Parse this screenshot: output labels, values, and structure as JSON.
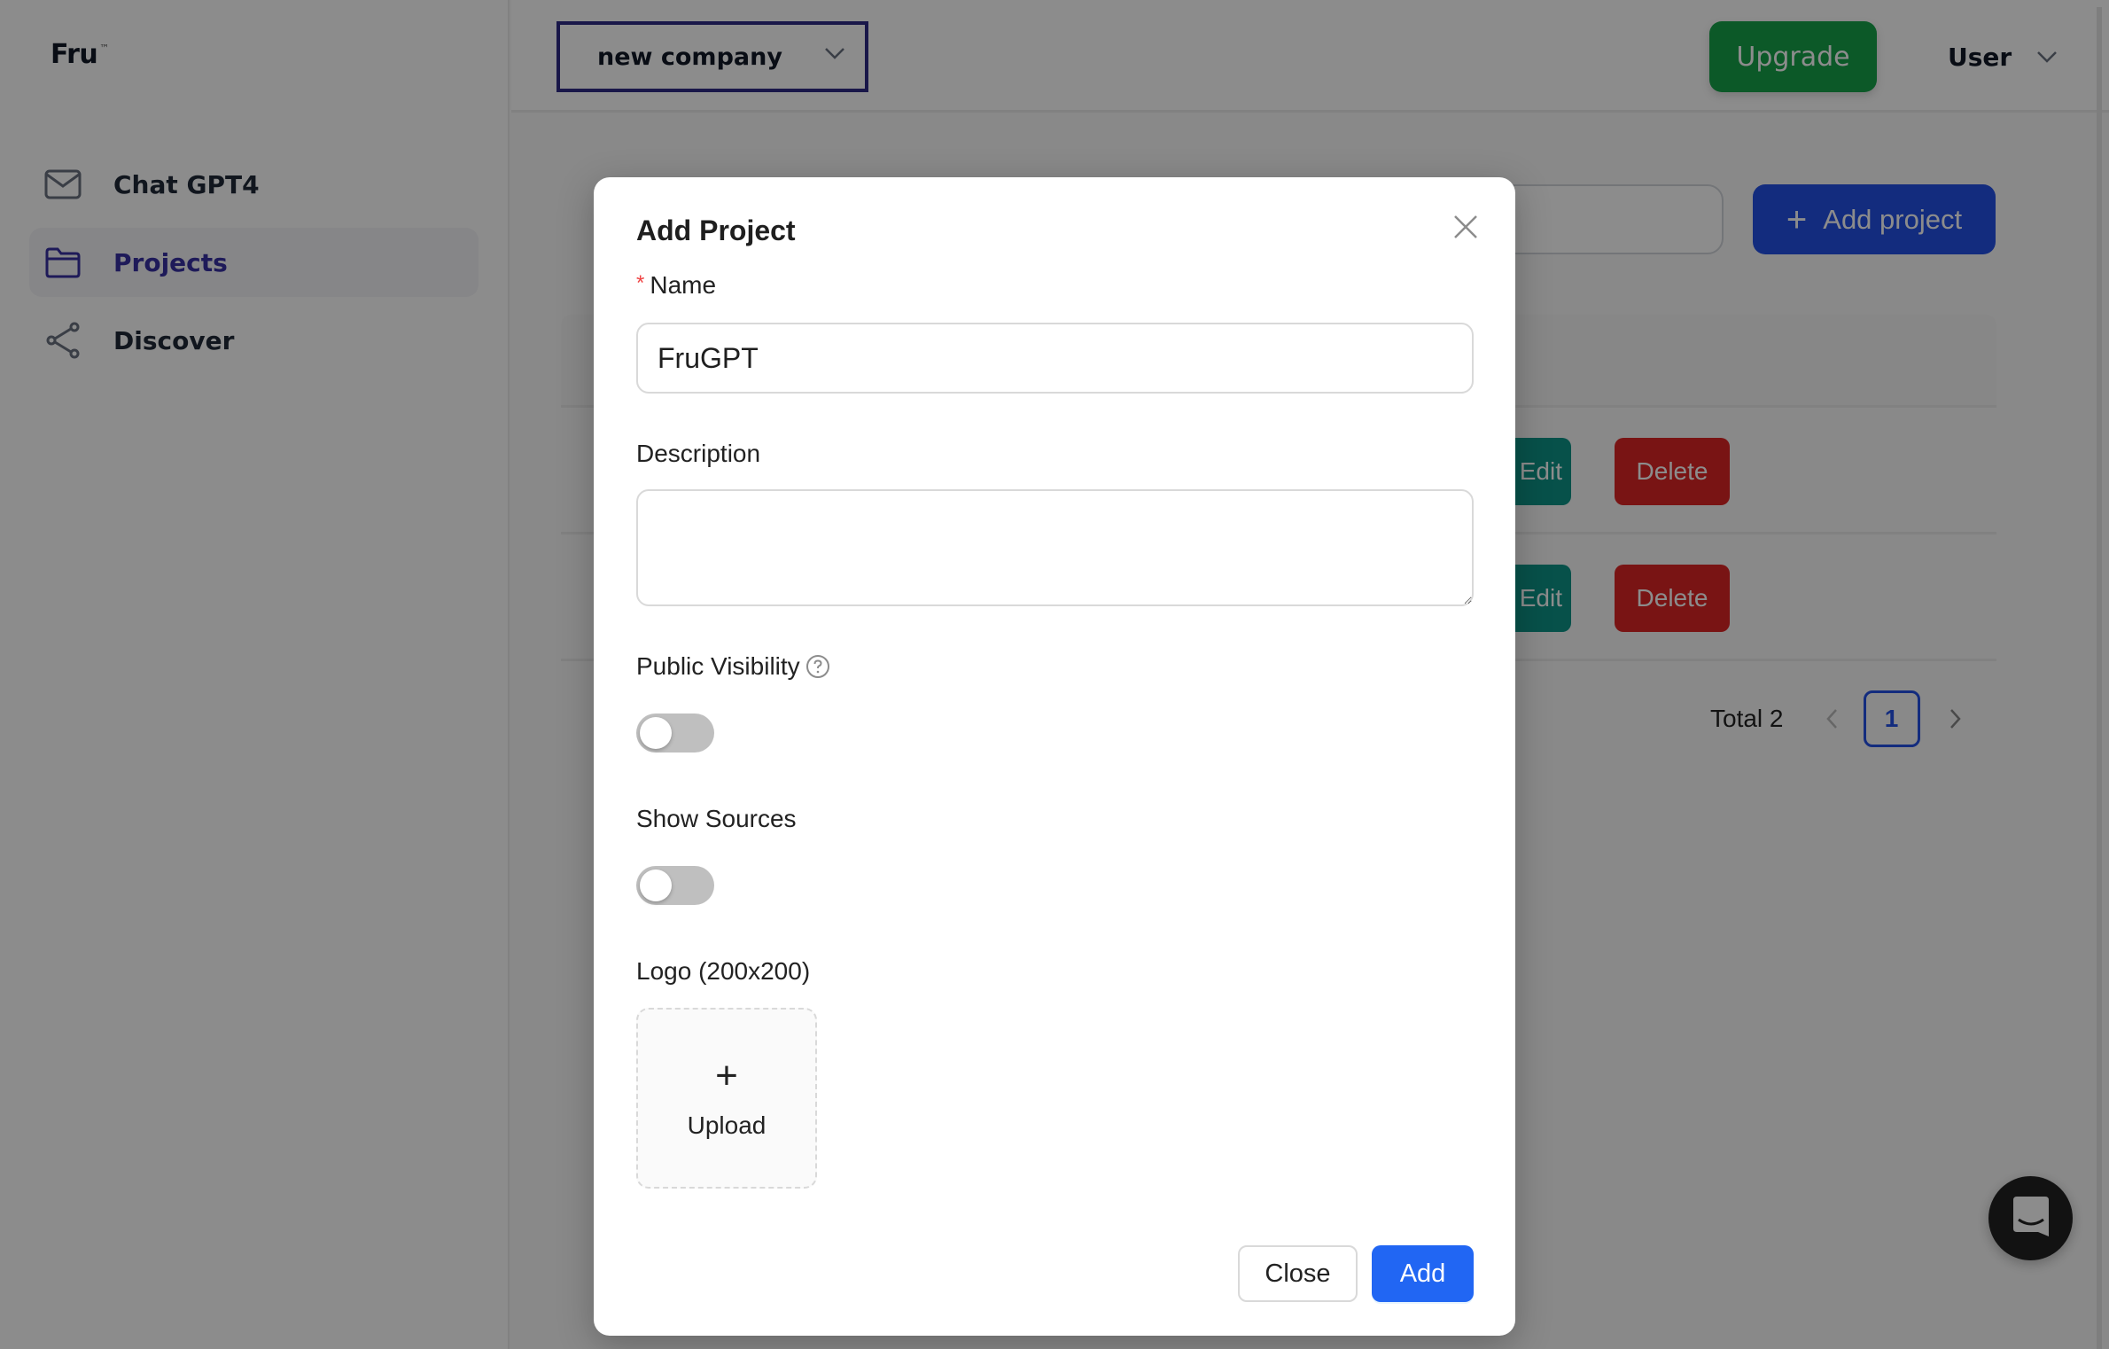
{
  "app": {
    "logo": "Fru",
    "logo_mark": "™"
  },
  "sidebar": {
    "items": [
      {
        "label": "Chat GPT4",
        "icon": "mail-icon",
        "active": false
      },
      {
        "label": "Projects",
        "icon": "folder-icon",
        "active": true
      },
      {
        "label": "Discover",
        "icon": "share-icon",
        "active": false
      }
    ]
  },
  "header": {
    "company_select": {
      "value": "new company"
    },
    "upgrade_label": "Upgrade",
    "user_label": "User"
  },
  "main": {
    "search": {
      "placeholder": "",
      "value": ""
    },
    "add_project_label": "Add project",
    "rows": [
      {
        "edit_label": "Edit",
        "delete_label": "Delete"
      },
      {
        "edit_label": "Edit",
        "delete_label": "Delete"
      }
    ],
    "pagination": {
      "total_label": "Total 2",
      "current_page": "1"
    }
  },
  "modal": {
    "title": "Add Project",
    "fields": {
      "name": {
        "label": "Name",
        "required_mark": "*",
        "value": "FruGPT"
      },
      "description": {
        "label": "Description",
        "value": ""
      },
      "public_visibility": {
        "label": "Public Visibility",
        "enabled": false
      },
      "show_sources": {
        "label": "Show Sources",
        "enabled": false
      },
      "logo": {
        "label": "Logo (200x200)",
        "upload_icon": "+",
        "upload_label": "Upload"
      }
    },
    "close_label": "Close",
    "add_label": "Add"
  },
  "colors": {
    "accent_purple": "#3730a3",
    "upgrade_green": "#16a34a",
    "primary_blue": "#2166f3",
    "delete_red": "#dc2626",
    "edit_teal": "#0d9488",
    "required_red": "#ef4444"
  }
}
